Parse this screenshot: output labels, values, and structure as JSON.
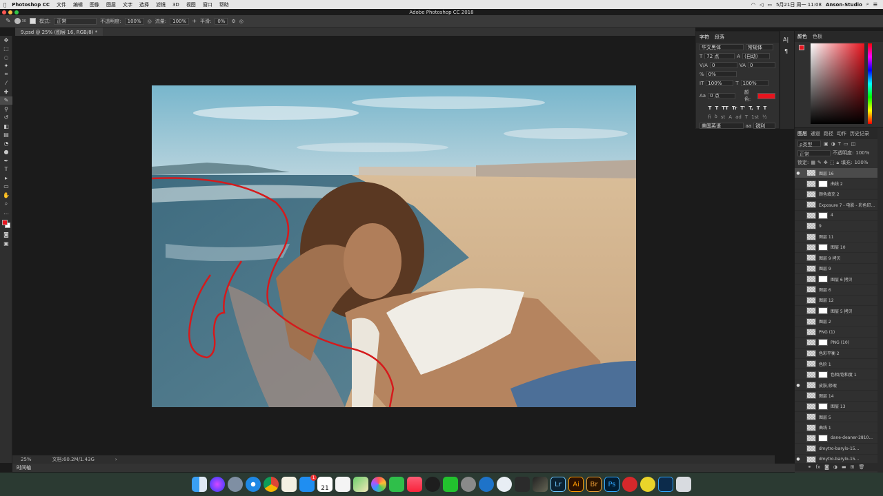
{
  "menubar": {
    "app": "Photoshop CC",
    "items": [
      "文件",
      "编辑",
      "图像",
      "图层",
      "文字",
      "选择",
      "滤镜",
      "3D",
      "视图",
      "窗口",
      "帮助"
    ],
    "datetime": "5月21日 周一 11:08",
    "user": "Anson-Studio"
  },
  "window": {
    "title": "Adobe Photoshop CC 2018"
  },
  "options": {
    "mode_label": "模式:",
    "mode_value": "正常",
    "opacity_label": "不透明度:",
    "opacity_value": "100%",
    "flow_label": "流量:",
    "flow_value": "100%",
    "smooth_label": "平滑:",
    "smooth_value": "0%",
    "brush_size": "30"
  },
  "document": {
    "tab_label": "9.psd @ 25% (图层 16, RGB/8) *",
    "zoom": "25%",
    "doc_info": "文档:60.2M/1.43G"
  },
  "char_panel": {
    "tabs": [
      "字符",
      "段落"
    ],
    "font_family": "华文黑体",
    "font_style": "常规体",
    "size": "72 点",
    "leading": "(自动)",
    "kerning_label": "V/A",
    "kerning": "0",
    "tracking": "0",
    "scale_pct": "0%",
    "vscale": "100%",
    "hscale": "100%",
    "baseline": "0 点",
    "color_label": "颜色:",
    "language": "美国英语",
    "antialias": "锐利",
    "style_buttons": [
      "T",
      "T",
      "TT",
      "Tr",
      "T'",
      "T,",
      "T",
      "T"
    ],
    "opentype_buttons": [
      "fi",
      "ꝺ",
      "st",
      "A",
      "ad",
      "T",
      "1st",
      "½"
    ]
  },
  "color_panel": {
    "tabs": [
      "颜色",
      "色板"
    ],
    "fg_color": "#e8141e"
  },
  "layers_panel": {
    "tabs": [
      "图层",
      "通道",
      "路径",
      "动作",
      "历史记录"
    ],
    "kind_label": "ρ类型",
    "blend_mode": "正常",
    "opacity_label": "不透明度:",
    "opacity": "100%",
    "lock_label": "锁定:",
    "fill_label": "填充:",
    "fill": "100%",
    "layers": [
      {
        "name": "图层 16",
        "visible": true,
        "selected": true
      },
      {
        "name": "曲线 2",
        "visible": false
      },
      {
        "name": "颜色填充 2",
        "visible": false
      },
      {
        "name": "Exposure 7 - 电影 - 彩色印...",
        "visible": false
      },
      {
        "name": "4",
        "visible": false
      },
      {
        "name": "9",
        "visible": false
      },
      {
        "name": "图层 11",
        "visible": false
      },
      {
        "name": "图层 10",
        "visible": false
      },
      {
        "name": "图层 9 拷贝",
        "visible": false
      },
      {
        "name": "图层 9",
        "visible": false
      },
      {
        "name": "图层 6 拷贝",
        "visible": false
      },
      {
        "name": "图层 6",
        "visible": false
      },
      {
        "name": "图层 12",
        "visible": false
      },
      {
        "name": "图层 5 拷贝",
        "visible": false
      },
      {
        "name": "图层 2",
        "visible": false
      },
      {
        "name": "PNG (1)",
        "visible": false
      },
      {
        "name": "PNG (10)",
        "visible": false
      },
      {
        "name": "色彩平衡 2",
        "visible": false
      },
      {
        "name": "色阶 1",
        "visible": false
      },
      {
        "name": "色相/饱和度 1",
        "visible": false
      },
      {
        "name": "皮肤,修瑕",
        "visible": true
      },
      {
        "name": "图层 14",
        "visible": false
      },
      {
        "name": "图层 13",
        "visible": false
      },
      {
        "name": "图层 5",
        "visible": false
      },
      {
        "name": "曲线 1",
        "visible": false
      },
      {
        "name": "dane-deaner-2810...",
        "visible": false
      },
      {
        "name": "dmytro-barylo-15...",
        "visible": false
      },
      {
        "name": "dmytro-barylo-15...",
        "visible": true
      }
    ]
  },
  "statusbar": {
    "timeline_label": "时间轴"
  },
  "dock": {
    "apps": [
      "finder-icon",
      "siri-icon",
      "launchpad-icon",
      "safari-icon",
      "chrome-icon",
      "notes-icon",
      "appstore-icon",
      "calendar-icon",
      "reminders-icon",
      "maps-icon",
      "photos-icon",
      "facetime-icon",
      "music-icon",
      "qq-icon",
      "wechat-icon",
      "preferences-icon",
      "edge-icon",
      "1password-icon",
      "arrow-icon",
      "finalcut-icon",
      "lightroom-icon",
      "illustrator-icon",
      "bridge-icon",
      "photoshop-icon",
      "netease-icon",
      "sogou-icon",
      "psd-file-icon",
      "trash-icon"
    ],
    "badge": "1",
    "calendar_day": "21",
    "lr": "Lr",
    "ai": "Ai",
    "br": "Br",
    "ps": "Ps"
  },
  "colors": {
    "accent_red": "#e8141e",
    "panel": "#303030",
    "workspace": "#1b1b1b"
  }
}
